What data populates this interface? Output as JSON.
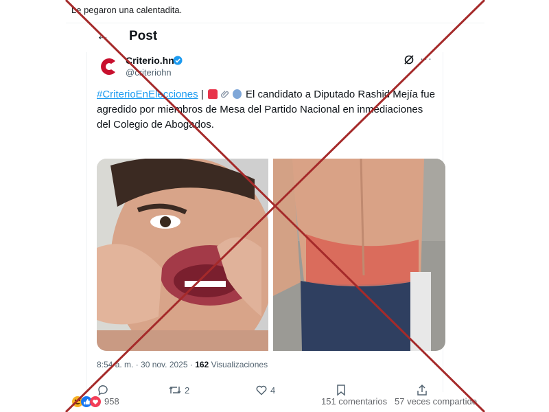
{
  "facebook_post": {
    "caption": "Le pegaron una calentadita.",
    "reactions_count": "958",
    "comments_count": "151 comentarios",
    "shares_count": "57 veces compartido"
  },
  "x_post": {
    "header_title": "Post",
    "author_name": "Criterio.hn",
    "author_handle": "@criteriohn",
    "hashtag": "#CriterioEnElecciones",
    "separator": " | ",
    "text": " El candidato a Diputado Rashid Mejía fue agredido por miembros de Mesa del Partido Nacional en inmediaciones del Colegio de Abogados.",
    "timestamp": "8:54 a. m. · 30 nov. 2025 · ",
    "views_count": "162",
    "views_label": " Visualizaciones",
    "retweet_count": "2",
    "like_count": "4",
    "icons": [
      "back-arrow-icon",
      "verified-badge-icon",
      "grok-icon",
      "more-icon",
      "siren-emoji",
      "paperclip-emoji",
      "tooth-emoji",
      "reply-icon",
      "retweet-icon",
      "like-icon",
      "bookmark-icon",
      "share-icon"
    ]
  },
  "colors": {
    "x_link_blue": "#1d9bf0",
    "x_text": "#0f1419",
    "x_muted": "#536471",
    "fact_check_red": "#a52a2a",
    "criterio_brand_red": "#c8102e"
  }
}
